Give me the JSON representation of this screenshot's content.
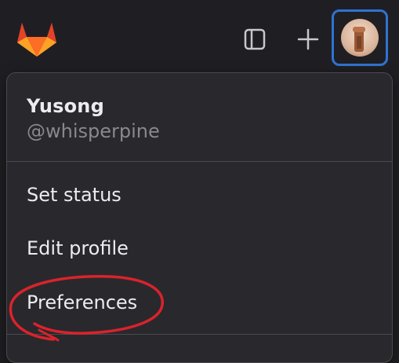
{
  "topbar": {
    "logo_icon": "gitlab-tanuki-icon",
    "sidebar_toggle_icon": "sidebar-toggle-icon",
    "new_icon": "plus-icon",
    "avatar_highlight_color": "#2f73d1"
  },
  "user_menu": {
    "name": "Yusong",
    "handle": "@whisperpine",
    "items": [
      {
        "label": "Set status"
      },
      {
        "label": "Edit profile"
      },
      {
        "label": "Preferences"
      }
    ]
  },
  "annotation": {
    "shape": "hand-drawn red circle around Preferences",
    "color": "#d9232b"
  }
}
